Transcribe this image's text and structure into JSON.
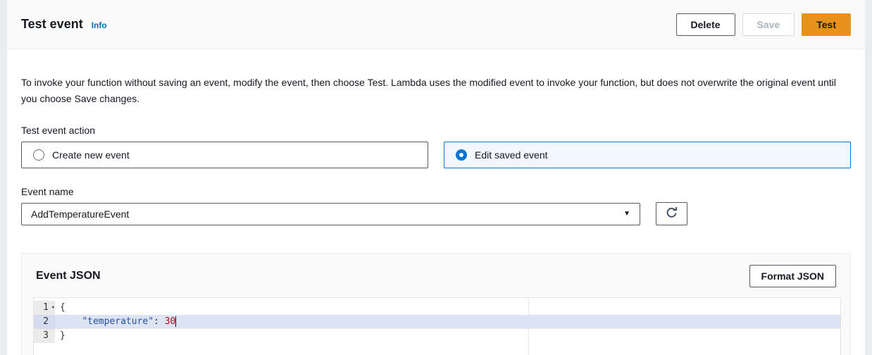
{
  "header": {
    "title": "Test event",
    "info_link": "Info",
    "delete_label": "Delete",
    "save_label": "Save",
    "test_label": "Test"
  },
  "description": "To invoke your function without saving an event, modify the event, then choose Test. Lambda uses the modified event to invoke your function, but does not overwrite the original event until you choose Save changes.",
  "form": {
    "action_label": "Test event action",
    "options": [
      {
        "label": "Create new event",
        "selected": false
      },
      {
        "label": "Edit saved event",
        "selected": true
      }
    ],
    "event_name_label": "Event name",
    "event_name_value": "AddTemperatureEvent",
    "select_caret_icon": "▼"
  },
  "editor_panel": {
    "title": "Event JSON",
    "format_button_label": "Format JSON",
    "code": {
      "lines": [
        {
          "number": "1",
          "fold": true,
          "active": false,
          "cursor": false,
          "tokens": [
            {
              "text": "{",
              "type": "plain"
            }
          ]
        },
        {
          "number": "2",
          "fold": false,
          "active": true,
          "cursor": true,
          "tokens": [
            {
              "text": "    ",
              "type": "plain"
            },
            {
              "text": "\"temperature\"",
              "type": "key"
            },
            {
              "text": ": ",
              "type": "plain"
            },
            {
              "text": "30",
              "type": "number"
            }
          ]
        },
        {
          "number": "3",
          "fold": false,
          "active": false,
          "cursor": false,
          "tokens": [
            {
              "text": "}",
              "type": "plain"
            }
          ]
        }
      ],
      "fold_caret_icon": "▾"
    }
  },
  "colors": {
    "accent_orange": "#e8921e",
    "link_blue": "#0073bb",
    "selected_blue": "#0972d3",
    "selected_bg": "#f0f7ff",
    "active_line": "#dce3f3",
    "token_key": "#2a4fa2",
    "token_number": "#a31515"
  }
}
